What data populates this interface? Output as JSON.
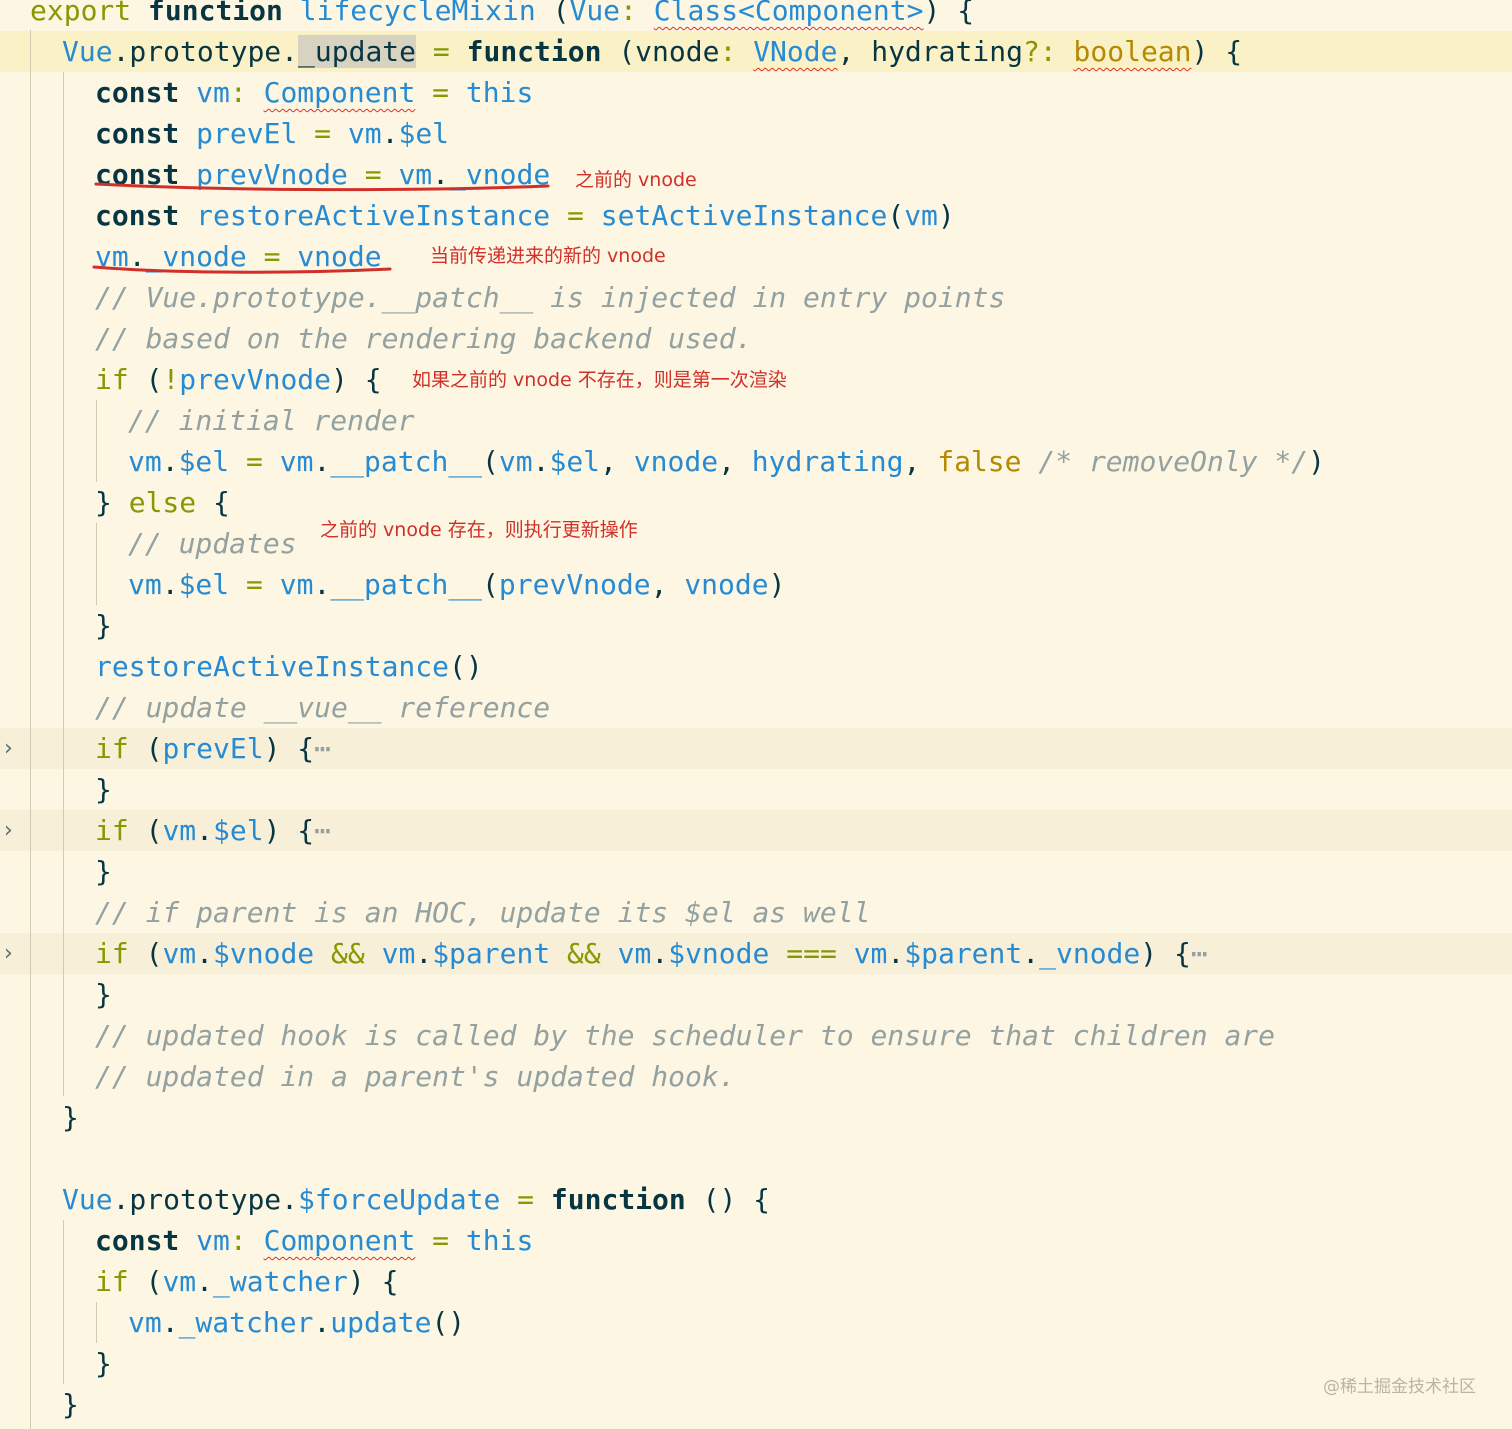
{
  "editor": {
    "lines": [
      [
        [
          "kw2",
          "export "
        ],
        [
          "kw",
          "function "
        ],
        [
          "id",
          "lifecycleMixin "
        ],
        [
          "pl",
          "("
        ],
        [
          "id",
          "Vue"
        ],
        [
          "op",
          ": "
        ],
        [
          "ty",
          "Class<Component>"
        ],
        [
          "pl",
          ") {"
        ]
      ],
      [
        [
          "id",
          "Vue"
        ],
        [
          "pl",
          ".prototype."
        ],
        [
          "sel",
          "_update"
        ],
        [
          "op",
          " = "
        ],
        [
          "kw",
          "function "
        ],
        [
          "pl",
          "(vnode"
        ],
        [
          "op",
          ": "
        ],
        [
          "ty",
          "VNode"
        ],
        [
          "pl",
          ", hydrating"
        ],
        [
          "op",
          "?: "
        ],
        [
          "tyb",
          "boolean"
        ],
        [
          "pl",
          ") {"
        ]
      ],
      [
        [
          "kw",
          "const "
        ],
        [
          "id",
          "vm"
        ],
        [
          "op",
          ": "
        ],
        [
          "ty",
          "Component"
        ],
        [
          "op",
          " = "
        ],
        [
          "id",
          "this"
        ]
      ],
      [
        [
          "kw",
          "const "
        ],
        [
          "id",
          "prevEl"
        ],
        [
          "op",
          " = "
        ],
        [
          "id",
          "vm"
        ],
        [
          "pl",
          "."
        ],
        [
          "id",
          "$el"
        ]
      ],
      [
        [
          "kw",
          "const "
        ],
        [
          "id",
          "prevVnode"
        ],
        [
          "op",
          " = "
        ],
        [
          "id",
          "vm"
        ],
        [
          "pl",
          "."
        ],
        [
          "id",
          "_vnode"
        ]
      ],
      [
        [
          "kw",
          "const "
        ],
        [
          "id",
          "restoreActiveInstance"
        ],
        [
          "op",
          " = "
        ],
        [
          "id",
          "setActiveInstance"
        ],
        [
          "pl",
          "("
        ],
        [
          "id",
          "vm"
        ],
        [
          "pl",
          ")"
        ]
      ],
      [
        [
          "id",
          "vm"
        ],
        [
          "pl",
          "."
        ],
        [
          "id",
          "_vnode"
        ],
        [
          "op",
          " = "
        ],
        [
          "id",
          "vnode"
        ]
      ],
      [
        [
          "cm",
          "// Vue.prototype.__patch__ is injected in entry points"
        ]
      ],
      [
        [
          "cm",
          "// based on the rendering backend used."
        ]
      ],
      [
        [
          "kw2",
          "if "
        ],
        [
          "pl",
          "("
        ],
        [
          "op",
          "!"
        ],
        [
          "id",
          "prevVnode"
        ],
        [
          "pl",
          ") {"
        ]
      ],
      [
        [
          "cm",
          "// initial render"
        ]
      ],
      [
        [
          "id",
          "vm"
        ],
        [
          "pl",
          "."
        ],
        [
          "id",
          "$el"
        ],
        [
          "op",
          " = "
        ],
        [
          "id",
          "vm"
        ],
        [
          "pl",
          "."
        ],
        [
          "id",
          "__patch__"
        ],
        [
          "pl",
          "("
        ],
        [
          "id",
          "vm"
        ],
        [
          "pl",
          "."
        ],
        [
          "id",
          "$el"
        ],
        [
          "pl",
          ", "
        ],
        [
          "id",
          "vnode"
        ],
        [
          "pl",
          ", "
        ],
        [
          "id",
          "hydrating"
        ],
        [
          "pl",
          ", "
        ],
        [
          "bo",
          "false "
        ],
        [
          "cm",
          "/* removeOnly */"
        ],
        [
          "pl",
          ")"
        ]
      ],
      [
        [
          "pl",
          "} "
        ],
        [
          "kw2",
          "else "
        ],
        [
          "pl",
          "{"
        ]
      ],
      [
        [
          "cm",
          "// updates"
        ]
      ],
      [
        [
          "id",
          "vm"
        ],
        [
          "pl",
          "."
        ],
        [
          "id",
          "$el"
        ],
        [
          "op",
          " = "
        ],
        [
          "id",
          "vm"
        ],
        [
          "pl",
          "."
        ],
        [
          "id",
          "__patch__"
        ],
        [
          "pl",
          "("
        ],
        [
          "id",
          "prevVnode"
        ],
        [
          "pl",
          ", "
        ],
        [
          "id",
          "vnode"
        ],
        [
          "pl",
          ")"
        ]
      ],
      [
        [
          "pl",
          "}"
        ]
      ],
      [
        [
          "id",
          "restoreActiveInstance"
        ],
        [
          "pl",
          "()"
        ]
      ],
      [
        [
          "cm",
          "// update __vue__ reference"
        ]
      ],
      [
        [
          "kw2",
          "if "
        ],
        [
          "pl",
          "("
        ],
        [
          "id",
          "prevEl"
        ],
        [
          "pl",
          ") {"
        ],
        [
          "cm",
          "⋯"
        ]
      ],
      [
        [
          "pl",
          "}"
        ]
      ],
      [
        [
          "kw2",
          "if "
        ],
        [
          "pl",
          "("
        ],
        [
          "id",
          "vm"
        ],
        [
          "pl",
          "."
        ],
        [
          "id",
          "$el"
        ],
        [
          "pl",
          ") {"
        ],
        [
          "cm",
          "⋯"
        ]
      ],
      [
        [
          "pl",
          "}"
        ]
      ],
      [
        [
          "cm",
          "// if parent is an HOC, update its $el as well"
        ]
      ],
      [
        [
          "kw2",
          "if "
        ],
        [
          "pl",
          "("
        ],
        [
          "id",
          "vm"
        ],
        [
          "pl",
          "."
        ],
        [
          "id",
          "$vnode"
        ],
        [
          "op",
          " && "
        ],
        [
          "id",
          "vm"
        ],
        [
          "pl",
          "."
        ],
        [
          "id",
          "$parent"
        ],
        [
          "op",
          " && "
        ],
        [
          "id",
          "vm"
        ],
        [
          "pl",
          "."
        ],
        [
          "id",
          "$vnode"
        ],
        [
          "op",
          " === "
        ],
        [
          "id",
          "vm"
        ],
        [
          "pl",
          "."
        ],
        [
          "id",
          "$parent"
        ],
        [
          "pl",
          "."
        ],
        [
          "id",
          "_vnode"
        ],
        [
          "pl",
          ") {"
        ],
        [
          "cm",
          "⋯"
        ]
      ],
      [
        [
          "pl",
          "}"
        ]
      ],
      [
        [
          "cm",
          "// updated hook is called by the scheduler to ensure that children are"
        ]
      ],
      [
        [
          "cm",
          "// updated in a parent's updated hook."
        ]
      ],
      [
        [
          "pl",
          "}"
        ]
      ],
      [],
      [
        [
          "id",
          "Vue"
        ],
        [
          "pl",
          ".prototype."
        ],
        [
          "id",
          "$forceUpdate"
        ],
        [
          "op",
          " = "
        ],
        [
          "kw",
          "function "
        ],
        [
          "pl",
          "() {"
        ]
      ],
      [
        [
          "kw",
          "const "
        ],
        [
          "id",
          "vm"
        ],
        [
          "op",
          ": "
        ],
        [
          "ty",
          "Component"
        ],
        [
          "op",
          " = "
        ],
        [
          "id",
          "this"
        ]
      ],
      [
        [
          "kw2",
          "if "
        ],
        [
          "pl",
          "("
        ],
        [
          "id",
          "vm"
        ],
        [
          "pl",
          "."
        ],
        [
          "id",
          "_watcher"
        ],
        [
          "pl",
          ") {"
        ]
      ],
      [
        [
          "id",
          "vm"
        ],
        [
          "pl",
          "."
        ],
        [
          "id",
          "_watcher"
        ],
        [
          "pl",
          "."
        ],
        [
          "id",
          "update"
        ],
        [
          "pl",
          "()"
        ]
      ],
      [
        [
          "pl",
          "}"
        ]
      ],
      [
        [
          "pl",
          "}"
        ]
      ]
    ],
    "folded_markers": [
      "›",
      "›",
      "›"
    ]
  },
  "annotations": {
    "note1": "之前的 vnode",
    "note2": "当前传递进来的新的 vnode",
    "note3": "如果之前的 vnode 不存在，则是第一次渲染",
    "note4": "之前的 vnode 存在，则执行更新操作"
  },
  "watermark": "@稀土掘金技术社区",
  "colors": {
    "background": "#fdf6e3",
    "keyword": "#073642",
    "identifier": "#268bd2",
    "operator": "#859900",
    "comment": "#93a1a1",
    "boolean": "#b58900",
    "annotation": "#d0302a"
  }
}
